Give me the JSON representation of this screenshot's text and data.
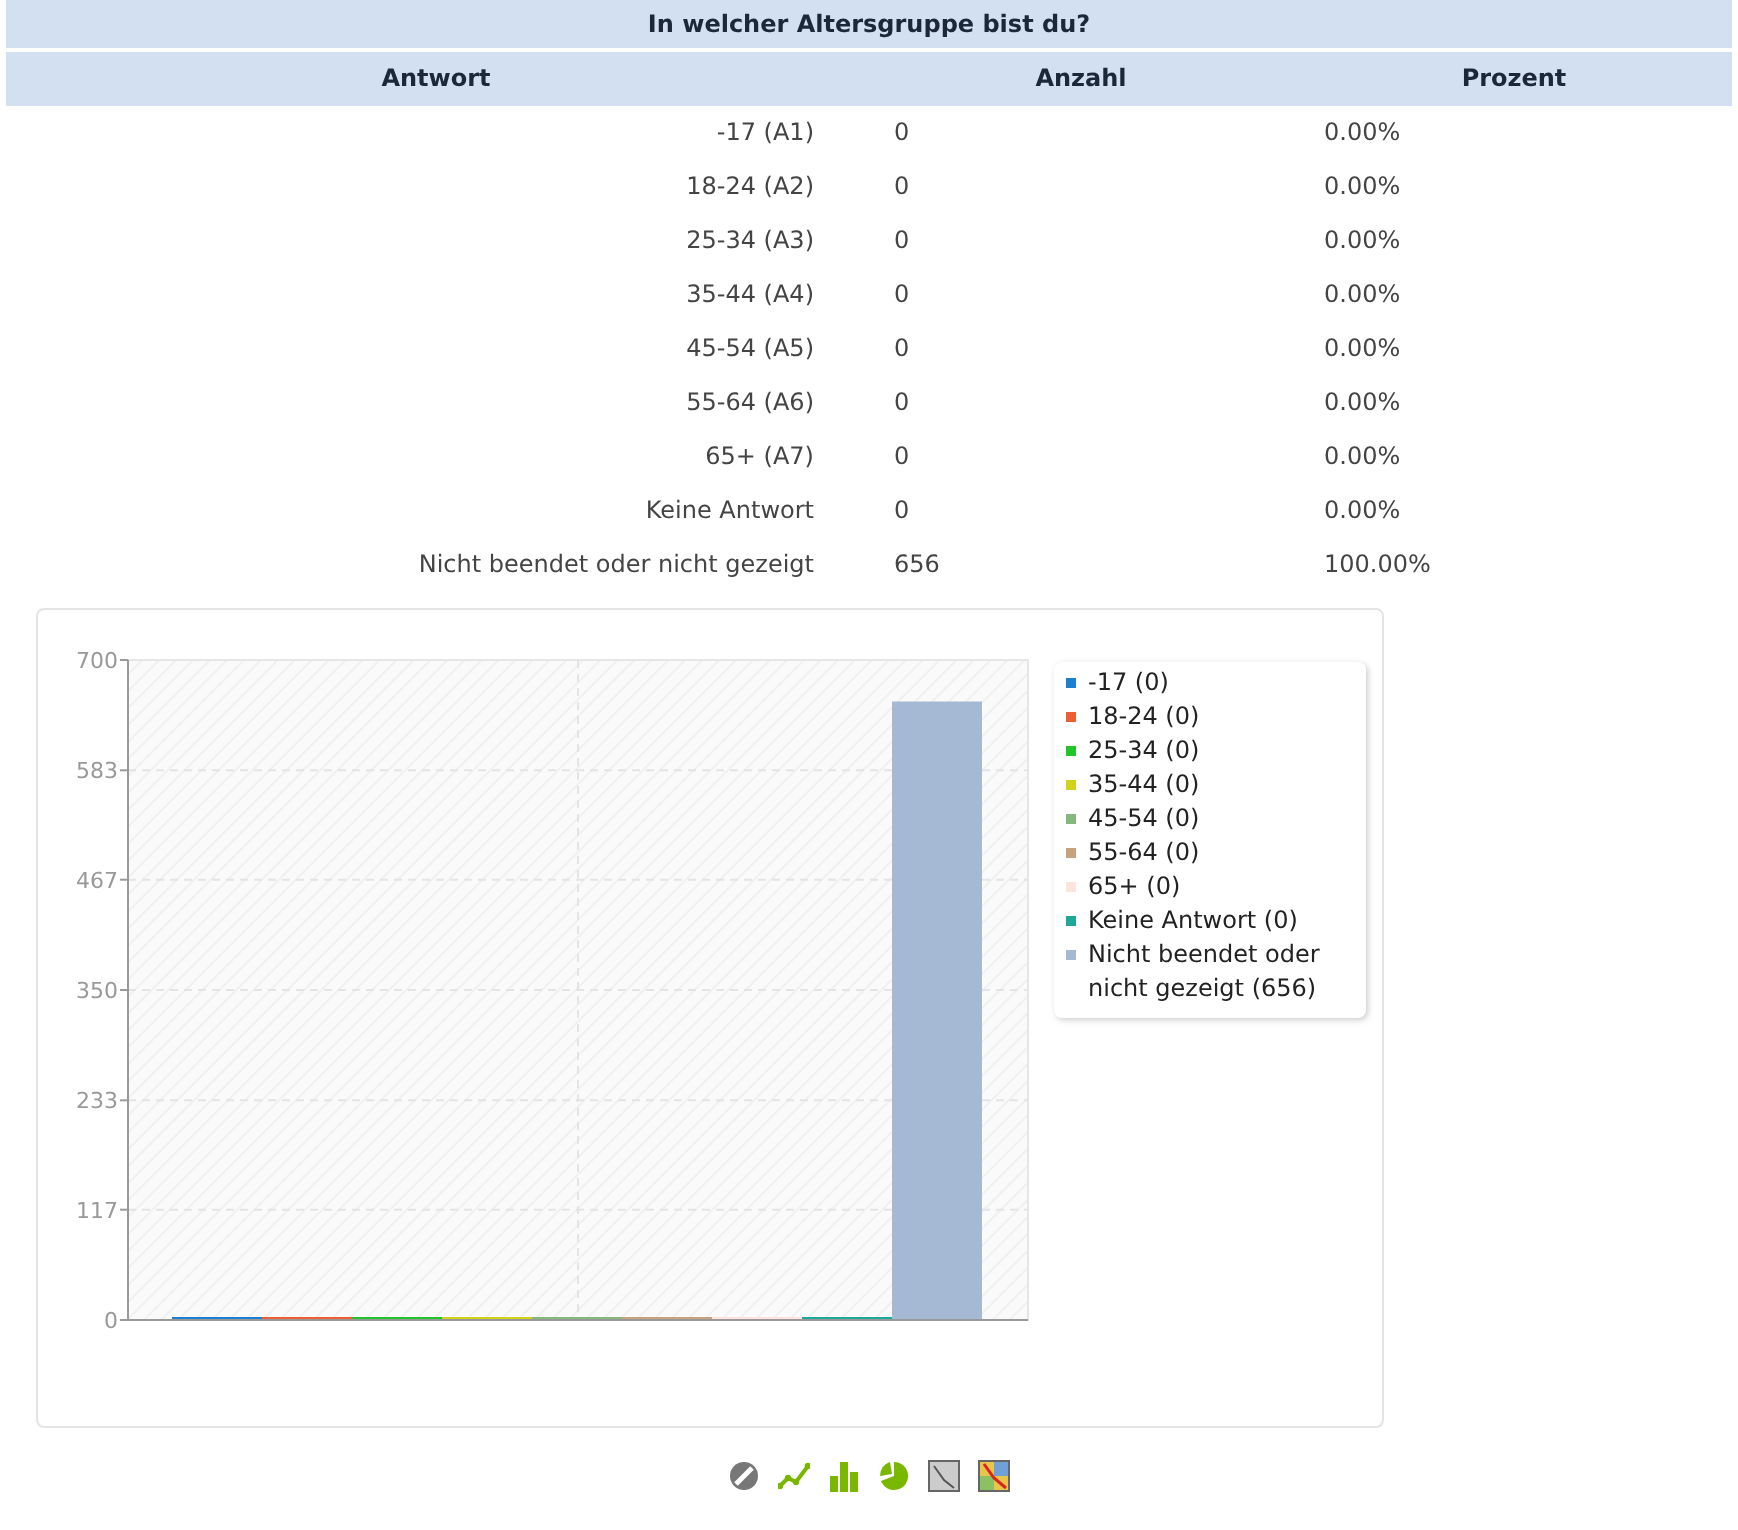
{
  "question": {
    "title": "In welcher Altersgruppe bist du?"
  },
  "table": {
    "columns": [
      "Antwort",
      "Anzahl",
      "Prozent"
    ],
    "rows": [
      [
        "-17 (A1)",
        "0",
        "0.00%"
      ],
      [
        "18-24 (A2)",
        "0",
        "0.00%"
      ],
      [
        "25-34 (A3)",
        "0",
        "0.00%"
      ],
      [
        "35-44 (A4)",
        "0",
        "0.00%"
      ],
      [
        "45-54 (A5)",
        "0",
        "0.00%"
      ],
      [
        "55-64 (A6)",
        "0",
        "0.00%"
      ],
      [
        "65+ (A7)",
        "0",
        "0.00%"
      ],
      [
        "Keine Antwort",
        "0",
        "0.00%"
      ],
      [
        "Nicht beendet oder nicht gezeigt",
        "656",
        "100.00%"
      ]
    ]
  },
  "chart": {
    "chart_data": {
      "type": "bar",
      "grid": true,
      "ylim": [
        0,
        700
      ],
      "yticks": [
        0,
        117,
        233,
        350,
        467,
        583,
        700
      ],
      "series": [
        {
          "name": "-17 (0)",
          "color": "#1f7fcf",
          "values": [
            0
          ]
        },
        {
          "name": "18-24 (0)",
          "color": "#ec5f33",
          "values": [
            0
          ]
        },
        {
          "name": "25-34 (0)",
          "color": "#22c42b",
          "values": [
            0
          ]
        },
        {
          "name": "35-44 (0)",
          "color": "#d2d21d",
          "values": [
            0
          ]
        },
        {
          "name": "45-54 (0)",
          "color": "#86b77c",
          "values": [
            0
          ]
        },
        {
          "name": "55-64 (0)",
          "color": "#c6a27d",
          "values": [
            0
          ]
        },
        {
          "name": "65+ (0)",
          "color": "#fce3dc",
          "values": [
            0
          ]
        },
        {
          "name": "Keine Antwort (0)",
          "color": "#1ea89a",
          "values": [
            0
          ]
        },
        {
          "name": "Nicht beendet oder nicht gezeigt (656)",
          "color": "#a6b9d4",
          "values": [
            656
          ]
        }
      ]
    }
  },
  "toolbar": [
    {
      "kind": "none"
    },
    {
      "kind": "line"
    },
    {
      "kind": "bar"
    },
    {
      "kind": "pie"
    },
    {
      "kind": "radar"
    },
    {
      "kind": "polar"
    }
  ]
}
